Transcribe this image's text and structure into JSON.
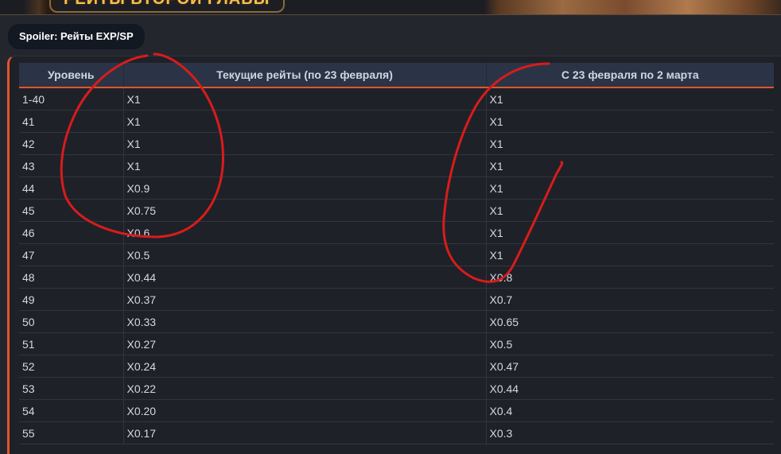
{
  "banner": {
    "title": "РЕЙТЫ ВТОРОЙ ГЛАВЫ"
  },
  "spoiler": {
    "label": "Spoiler: Рейты EXP/SP"
  },
  "table": {
    "headers": [
      "Уровень",
      "Текущие рейты (по 23 февраля)",
      "С 23 февраля по 2 марта"
    ],
    "rows": [
      [
        "1-40",
        "X1",
        "X1"
      ],
      [
        "41",
        "X1",
        "X1"
      ],
      [
        "42",
        "X1",
        "X1"
      ],
      [
        "43",
        "X1",
        "X1"
      ],
      [
        "44",
        "X0.9",
        "X1"
      ],
      [
        "45",
        "X0.75",
        "X1"
      ],
      [
        "46",
        "X0.6",
        "X1"
      ],
      [
        "47",
        "X0.5",
        "X1"
      ],
      [
        "48",
        "X0.44",
        "X0.8"
      ],
      [
        "49",
        "X0.37",
        "X0.7"
      ],
      [
        "50",
        "X0.33",
        "X0.65"
      ],
      [
        "51",
        "X0.27",
        "X0.5"
      ],
      [
        "52",
        "X0.24",
        "X0.47"
      ],
      [
        "53",
        "X0.22",
        "X0.44"
      ],
      [
        "54",
        "X0.20",
        "X0.4"
      ],
      [
        "55",
        "X0.17",
        "X0.3"
      ]
    ]
  },
  "annotation": {
    "color": "#d81c1c"
  },
  "colors": {
    "accent": "#e0562a",
    "header_bg": "#2b3446",
    "page_bg": "#24262e"
  }
}
